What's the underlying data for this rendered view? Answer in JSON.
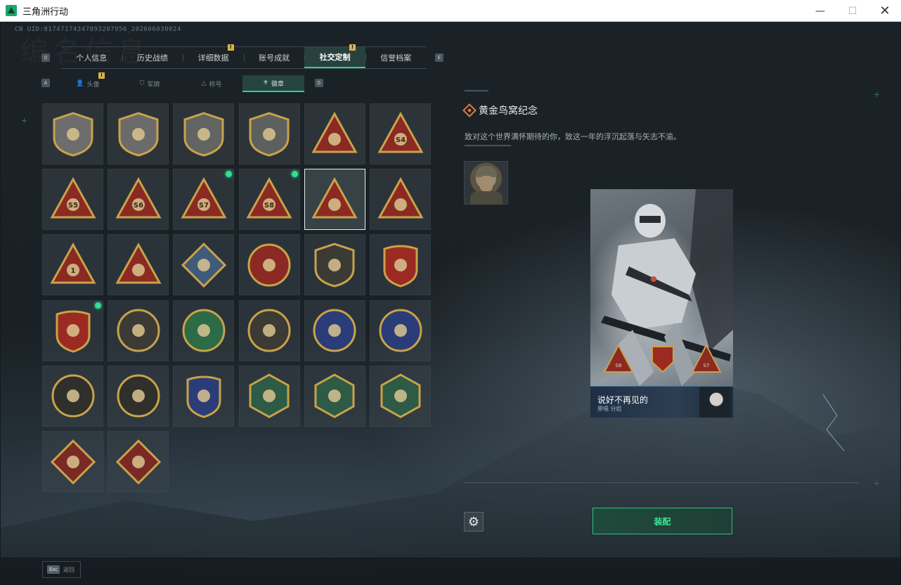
{
  "window": {
    "title": "三角洲行动"
  },
  "uid": "CN UID:81747174347893207956_202606030024",
  "watermark": "编名信息",
  "nav": {
    "left_key": "Q",
    "right_key": "E",
    "tabs": [
      {
        "label": "个人信息",
        "active": false,
        "alert": ""
      },
      {
        "label": "历史战绩",
        "active": false,
        "alert": ""
      },
      {
        "label": "详细数据",
        "active": false,
        "alert": "!"
      },
      {
        "label": "账号成就",
        "active": false,
        "alert": ""
      },
      {
        "label": "社交定制",
        "active": true,
        "alert": "!"
      },
      {
        "label": "信誉档案",
        "active": false,
        "alert": ""
      }
    ]
  },
  "subnav": {
    "left_key": "A",
    "right_key": "D",
    "tabs": [
      {
        "icon": "person-icon",
        "label": "头像",
        "active": false,
        "alert": "!"
      },
      {
        "icon": "flag-icon",
        "label": "军牌",
        "active": false,
        "alert": ""
      },
      {
        "icon": "triangle-icon",
        "label": "称号",
        "active": false,
        "alert": ""
      },
      {
        "icon": "medal-icon",
        "label": "徽章",
        "active": true,
        "alert": ""
      }
    ]
  },
  "badges": [
    {
      "name": "badge-shield-triangle",
      "shape": "shield",
      "color": "#6c6d6c",
      "new": false
    },
    {
      "name": "badge-helicopter",
      "shape": "shield",
      "color": "#6a6b6a",
      "new": false
    },
    {
      "name": "badge-diamond-emblem",
      "shape": "shield",
      "color": "#626462",
      "new": false
    },
    {
      "name": "badge-dagger",
      "shape": "shield",
      "color": "#5e605f",
      "new": false
    },
    {
      "name": "badge-radar",
      "shape": "triangle",
      "color": "#8b2a22",
      "new": false
    },
    {
      "name": "badge-s4",
      "shape": "triangle",
      "color": "#8b2a22",
      "new": false,
      "label": "S4"
    },
    {
      "name": "badge-s5",
      "shape": "triangle",
      "color": "#8b2a22",
      "new": false,
      "label": "S5"
    },
    {
      "name": "badge-s6",
      "shape": "triangle",
      "color": "#8b2a22",
      "new": false,
      "label": "S6"
    },
    {
      "name": "badge-s7",
      "shape": "triangle",
      "color": "#8b2a22",
      "new": true,
      "label": "S7"
    },
    {
      "name": "badge-s8",
      "shape": "triangle",
      "color": "#8b2a22",
      "new": true,
      "label": "S8"
    },
    {
      "name": "badge-golden-nest",
      "shape": "triangle",
      "color": "#8b2a22",
      "new": false,
      "selected": true
    },
    {
      "name": "badge-tank",
      "shape": "triangle",
      "color": "#8b2a22",
      "new": false
    },
    {
      "name": "badge-number-one",
      "shape": "triangle",
      "color": "#8b2a22",
      "new": false,
      "label": "1"
    },
    {
      "name": "badge-soldiers",
      "shape": "triangle",
      "color": "#8b2a22",
      "new": false
    },
    {
      "name": "badge-rocket-launcher",
      "shape": "diamond",
      "color": "#3f5a7a",
      "new": false
    },
    {
      "name": "badge-star-compass",
      "shape": "circle",
      "color": "#8b2a22",
      "new": false
    },
    {
      "name": "badge-gold-shield",
      "shape": "shield",
      "color": "#3b3a35",
      "new": false
    },
    {
      "name": "badge-star-shield-blue",
      "shape": "crest",
      "color": "#9b2b22",
      "new": false
    },
    {
      "name": "badge-star-shield-red",
      "shape": "crest",
      "color": "#9b2b22",
      "new": true
    },
    {
      "name": "badge-egg-nest",
      "shape": "circle",
      "color": "#3c3a36",
      "new": false
    },
    {
      "name": "badge-green-skull",
      "shape": "circle",
      "color": "#2d6b46",
      "new": false
    },
    {
      "name": "badge-sun-tank",
      "shape": "circle",
      "color": "#3b3a35",
      "new": false
    },
    {
      "name": "badge-blue-rifle",
      "shape": "circle",
      "color": "#2a3d78",
      "new": false
    },
    {
      "name": "badge-blue-rifle-2",
      "shape": "circle",
      "color": "#2a3d78",
      "new": false
    },
    {
      "name": "badge-no-rifle",
      "shape": "circle",
      "color": "#2f2f2b",
      "new": false
    },
    {
      "name": "badge-no-rifle-2",
      "shape": "circle",
      "color": "#2f2f2b",
      "new": false
    },
    {
      "name": "badge-sword-crest",
      "shape": "crest",
      "color": "#2a3d78",
      "new": false
    },
    {
      "name": "badge-wasp",
      "shape": "hex",
      "color": "#2d5b45",
      "new": false
    },
    {
      "name": "badge-wasp-2",
      "shape": "hex",
      "color": "#2d5b45",
      "new": false
    },
    {
      "name": "badge-wrench",
      "shape": "hex",
      "color": "#2d5b45",
      "new": false
    },
    {
      "name": "badge-dragon",
      "shape": "diamond",
      "color": "#7a2a24",
      "new": false
    },
    {
      "name": "badge-runner",
      "shape": "diamond",
      "color": "#7a2a24",
      "new": false
    }
  ],
  "detail": {
    "title": "黄金鸟窝纪念",
    "description": "致对这个世界满怀期待的你，致这一年的浮沉起落与矢志不渝。"
  },
  "card": {
    "strip_title": "说好不再见的",
    "strip_sub": "原唱 分组",
    "mini_badge_labels": [
      "S8",
      "",
      "S7"
    ]
  },
  "actions": {
    "equip_label": "装配"
  },
  "footer": {
    "esc_key": "Esc",
    "esc_label": "返回"
  },
  "colors": {
    "accent_green": "#2bd58a",
    "alert_yellow": "#d8b447",
    "detail_icon_orange": "#e27a3e"
  }
}
